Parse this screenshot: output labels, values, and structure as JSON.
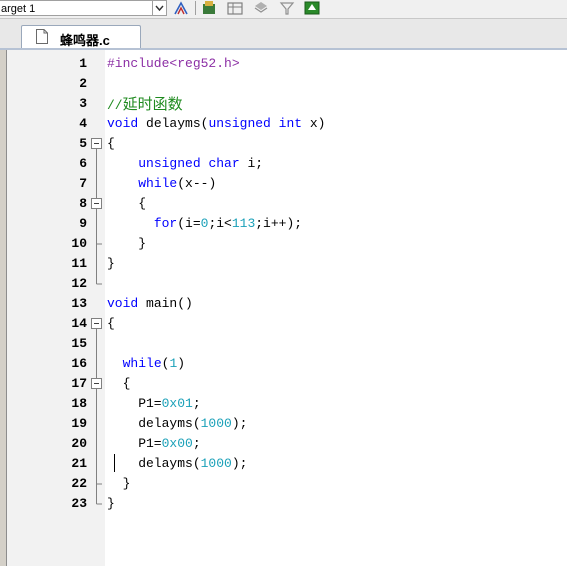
{
  "toolbar": {
    "target_label": "arget 1",
    "icons": [
      "dropdown-arrow-icon",
      "options-for-target-icon",
      "manage-components-icon",
      "file-extensions-icon",
      "pack-installer-icon",
      "select-packs-icon",
      "manage-rte-icon"
    ]
  },
  "tabs": [
    {
      "label": "蜂鸣器.c",
      "active": true,
      "icon": "file-icon"
    }
  ],
  "colors": {
    "keyword": "#0000ff",
    "number": "#1aa0b8",
    "preprocessor": "#8c2fa5",
    "comment": "#1e8a1e"
  },
  "editor": {
    "line_numbers": [
      "1",
      "2",
      "3",
      "4",
      "5",
      "6",
      "7",
      "8",
      "9",
      "10",
      "11",
      "12",
      "13",
      "14",
      "15",
      "16",
      "17",
      "18",
      "19",
      "20",
      "21",
      "22",
      "23"
    ],
    "lines": {
      "l1": "#include<reg52.h>",
      "l3_slashes": "//",
      "l3_text": "延时函数",
      "l4_void": "void",
      "l4_mid": " delayms(",
      "l4_unsigned": "unsigned",
      "l4_sp": " ",
      "l4_int": "int",
      "l4_end": " x)",
      "l5": "{",
      "l6_indent": "    ",
      "l6_unsigned": "unsigned",
      "l6_sp": " ",
      "l6_char": "char",
      "l6_end": " i;",
      "l7_indent": "    ",
      "l7_while": "while",
      "l7_end": "(x--)",
      "l8": "    {",
      "l9_indent": "      ",
      "l9_for": "for",
      "l9_a": "(i=",
      "l9_zero": "0",
      "l9_b": ";i<",
      "l9_num": "113",
      "l9_c": ";i++);",
      "l10": "    }",
      "l11": "}",
      "l13_void": "void",
      "l13_end": " main()",
      "l14": "{",
      "l16_indent": "  ",
      "l16_while": "while",
      "l16_a": "(",
      "l16_one": "1",
      "l16_b": ")",
      "l17": "  {",
      "l18_a": "    P1=",
      "l18_val": "0x01",
      "l18_b": ";",
      "l19_a": "    delayms(",
      "l19_val": "1000",
      "l19_b": ");",
      "l20_a": "    P1=",
      "l20_val": "0x00",
      "l20_b": ";",
      "l21_a": "    delayms(",
      "l21_val": "1000",
      "l21_b": ");",
      "l22": "  }",
      "l23": "}"
    }
  }
}
